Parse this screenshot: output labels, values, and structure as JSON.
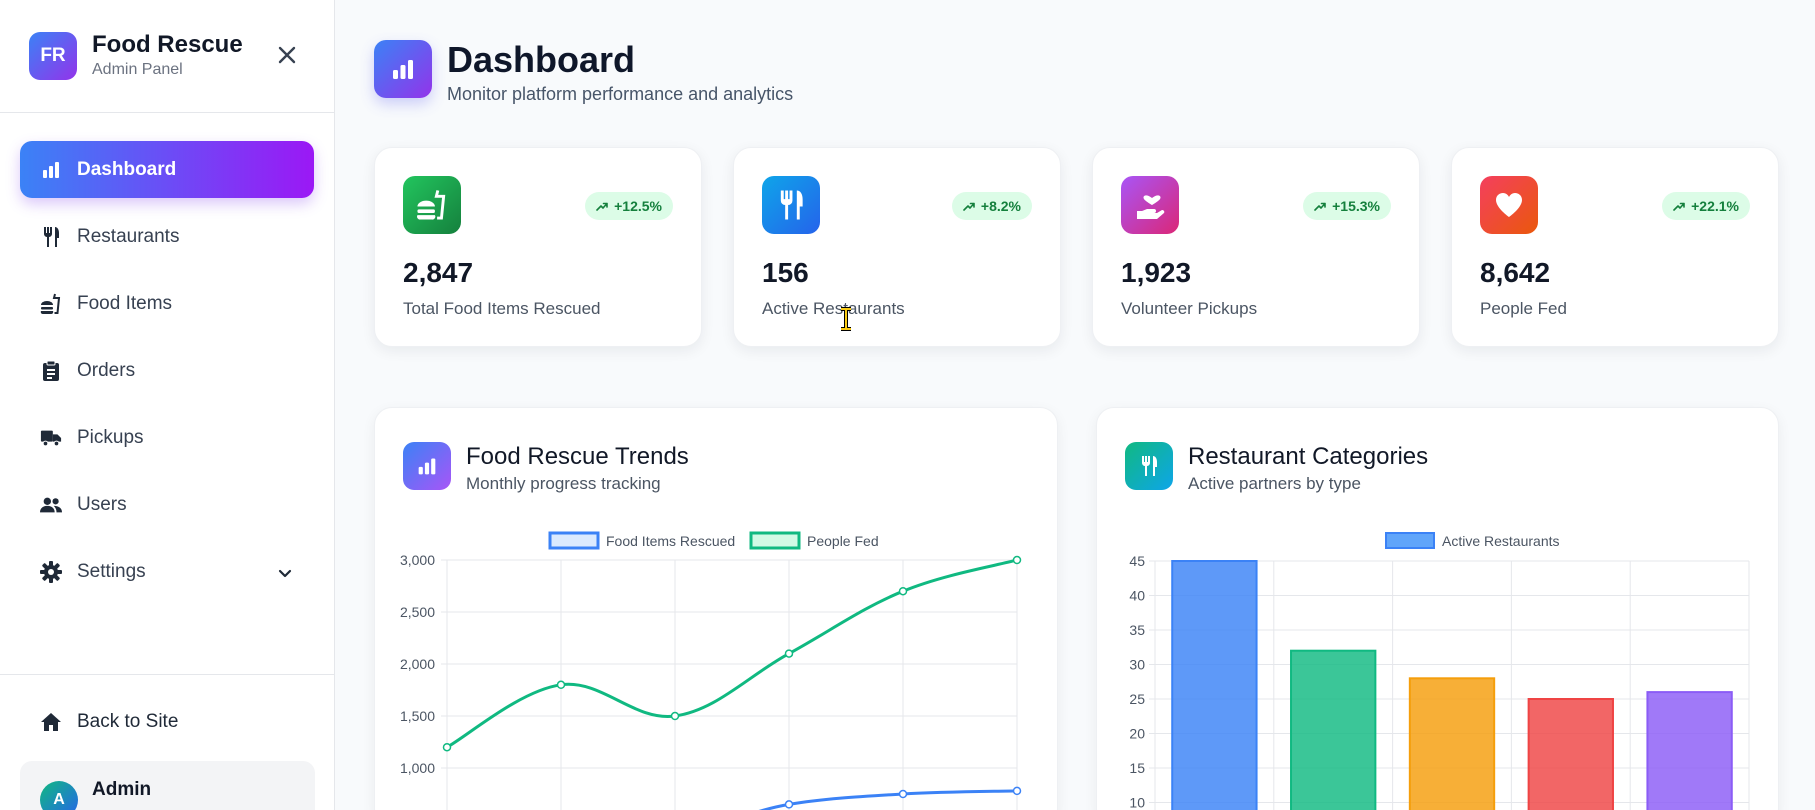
{
  "brand": {
    "logo_text": "FR",
    "title": "Food Rescue",
    "subtitle": "Admin Panel"
  },
  "nav": {
    "items": [
      {
        "label": "Dashboard",
        "icon": "bar-chart-icon",
        "active": true
      },
      {
        "label": "Restaurants",
        "icon": "utensils-icon"
      },
      {
        "label": "Food Items",
        "icon": "hamburger-icon"
      },
      {
        "label": "Orders",
        "icon": "clipboard-icon"
      },
      {
        "label": "Pickups",
        "icon": "truck-icon"
      },
      {
        "label": "Users",
        "icon": "users-icon"
      },
      {
        "label": "Settings",
        "icon": "gear-icon",
        "has_submenu": true
      }
    ],
    "back_to_site": "Back to Site",
    "user": {
      "avatar_text": "A",
      "name": "Admin"
    }
  },
  "page": {
    "title": "Dashboard",
    "subtitle": "Monitor platform performance and analytics"
  },
  "stats": [
    {
      "value": "2,847",
      "label": "Total Food Items Rescued",
      "change": "+12.5%",
      "icon": "hamburger-icon",
      "color": "#16a34a"
    },
    {
      "value": "156",
      "label": "Active Restaurants",
      "change": "+8.2%",
      "icon": "utensils-icon",
      "color": "#0ea5e9"
    },
    {
      "value": "1,923",
      "label": "Volunteer Pickups",
      "change": "+15.3%",
      "icon": "hand-heart-icon",
      "color": "#c026d3"
    },
    {
      "value": "8,642",
      "label": "People Fed",
      "change": "+22.1%",
      "icon": "heart-icon",
      "color": "#ef4444"
    }
  ],
  "trends_card": {
    "title": "Food Rescue Trends",
    "subtitle": "Monthly progress tracking"
  },
  "categories_card": {
    "title": "Restaurant Categories",
    "subtitle": "Active partners by type"
  },
  "chart_data": [
    {
      "type": "line",
      "title": "",
      "ylim": [
        1000,
        3000
      ],
      "yticks": [
        "3,000",
        "2,500",
        "2,000",
        "1,500",
        "1,000"
      ],
      "legend_position": "top",
      "grid": true,
      "series": [
        {
          "name": "Food Items Rescued",
          "color": "#3b82f6",
          "values": [
            null,
            null,
            null,
            650,
            750,
            780
          ]
        },
        {
          "name": "People Fed",
          "color": "#10b981",
          "values": [
            1200,
            1800,
            1500,
            2100,
            2700,
            3000
          ]
        }
      ]
    },
    {
      "type": "bar",
      "title": "",
      "ylim": [
        10,
        45
      ],
      "yticks": [
        "45",
        "40",
        "35",
        "30",
        "25",
        "20",
        "15",
        "10"
      ],
      "legend_position": "top",
      "grid": true,
      "series": [
        {
          "name": "Active Restaurants",
          "values": [
            45,
            32,
            28,
            25,
            26
          ]
        }
      ],
      "bar_colors": [
        "#3b82f6",
        "#10b981",
        "#f59e0b",
        "#ef4444",
        "#8b5cf6"
      ]
    }
  ]
}
